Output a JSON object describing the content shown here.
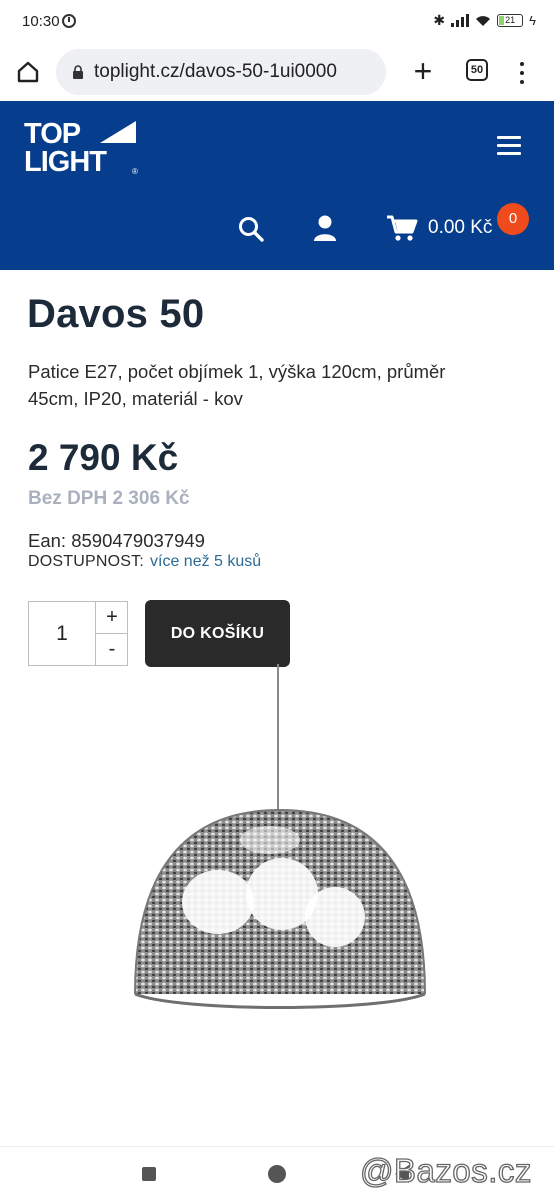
{
  "status_bar": {
    "time": "10:30",
    "battery": "21"
  },
  "browser": {
    "url": "toplight.cz/davos-50-1ui0000",
    "tab_count": "50"
  },
  "header": {
    "logo_line1": "TOP",
    "logo_line2": "LIGHT",
    "logo_reg": "®",
    "cart_total": "0.00 Kč",
    "cart_count": "0",
    "brand_color": "#063d8c",
    "badge_color": "#ef4b1d"
  },
  "product": {
    "title": "Davos 50",
    "description": "Patice E27, počet objímek 1, výška 120cm, průměr 45cm, IP20, materiál - kov",
    "price": "2 790 Kč",
    "price_net": "Bez DPH 2 306 Kč",
    "ean": "Ean: 8590479037949",
    "availability_label": "DOSTUPNOST:",
    "availability_value": "více než 5 kusů",
    "quantity": "1",
    "qty_plus": "+",
    "qty_minus": "-",
    "add_to_cart_label": "DO KOŠÍKU"
  },
  "watermark": "@Bazos.cz",
  "icons": [
    "alarm-icon",
    "bluetooth-icon",
    "signal-icon",
    "wifi-icon",
    "battery-icon",
    "home-icon",
    "lock-icon",
    "plus-icon",
    "tabs-icon",
    "menu-dots-icon",
    "hamburger-icon",
    "search-icon",
    "user-icon",
    "cart-icon",
    "nav-square-icon",
    "nav-circle-icon",
    "nav-back-icon"
  ]
}
